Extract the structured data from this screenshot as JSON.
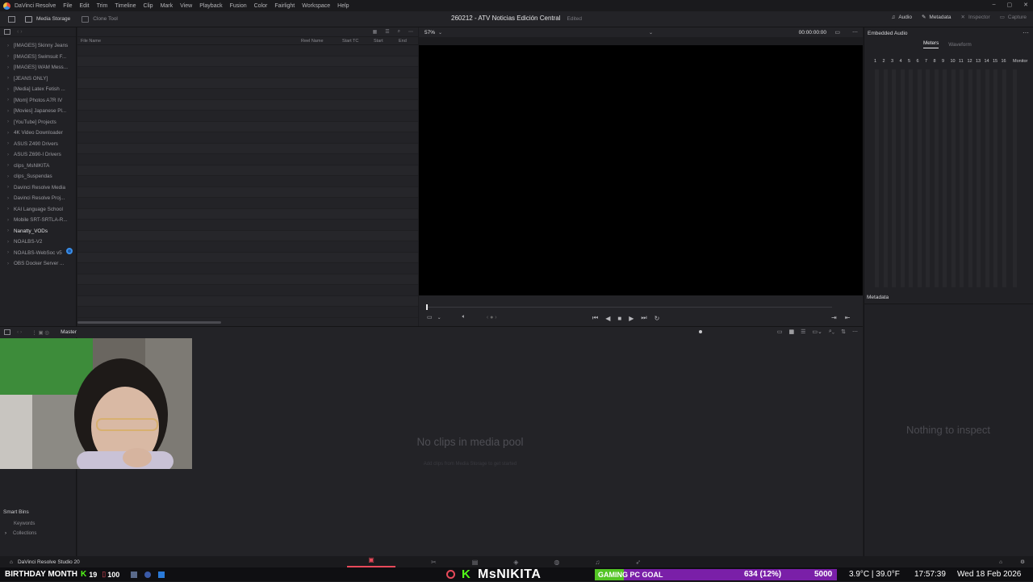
{
  "menubar": {
    "app_name": "DaVinci Resolve",
    "items": [
      "File",
      "Edit",
      "Trim",
      "Timeline",
      "Clip",
      "Mark",
      "View",
      "Playback",
      "Fusion",
      "Color",
      "Fairlight",
      "Workspace",
      "Help"
    ]
  },
  "toolbar": {
    "media_storage": "Media Storage",
    "clone_tool": "Clone Tool",
    "project_title": "260212 - ATV Noticias Edición Central",
    "edited": "Edited",
    "right_items": [
      "Audio",
      "Metadata",
      "Inspector",
      "Capture"
    ]
  },
  "tree": {
    "items": [
      {
        "label": "[IMAGES] Skinny Jeans",
        "bright": false
      },
      {
        "label": "[IMAGES] Swimsuit F...",
        "bright": false
      },
      {
        "label": "[IMAGES] WAM Mess...",
        "bright": false
      },
      {
        "label": "[JEANS ONLY]",
        "bright": false
      },
      {
        "label": "[Media] Latex Fetish ...",
        "bright": false
      },
      {
        "label": "[Mom] Photos A7R IV",
        "bright": false
      },
      {
        "label": "[Movies] Japanese Pl...",
        "bright": false
      },
      {
        "label": "[YouTube] Projects",
        "bright": false
      },
      {
        "label": "4K Video Downloader",
        "bright": false
      },
      {
        "label": "ASUS Z490 Drivers",
        "bright": false
      },
      {
        "label": "ASUS Z690-I Drivers",
        "bright": false
      },
      {
        "label": "clips_MsNIKITA",
        "bright": false
      },
      {
        "label": "clips_Suspendas",
        "bright": false
      },
      {
        "label": "Davinci Resolve Media",
        "bright": false
      },
      {
        "label": "Davinci Resolve Proj...",
        "bright": false
      },
      {
        "label": "KAI Language School",
        "bright": false
      },
      {
        "label": "Mobile SRT-SRTLA-R...",
        "bright": false
      },
      {
        "label": "Nanatty_VODs",
        "bright": true
      },
      {
        "label": "NOALBS-V2",
        "bright": false
      },
      {
        "label": "NOALBS-WebSoc v5",
        "bright": false
      },
      {
        "label": "OBS Docker Server ...",
        "bright": false
      }
    ]
  },
  "browser": {
    "columns": [
      "File Name",
      "Reel Name",
      "Start TC",
      "Start",
      "End"
    ]
  },
  "viewer": {
    "zoom": "57%",
    "timecode": "00:00:00:00"
  },
  "inspector": {
    "panel_title": "Embedded Audio",
    "tabs": [
      "Meters",
      "Waveform"
    ],
    "meter_numbers": [
      "1",
      "2",
      "3",
      "4",
      "5",
      "6",
      "7",
      "8",
      "9",
      "10",
      "11",
      "12",
      "13",
      "14",
      "15",
      "16"
    ],
    "monitor": "Monitor",
    "metadata_title": "Metadata",
    "nothing": "Nothing to inspect"
  },
  "media_pool": {
    "bin": "Master",
    "no_clips": "No clips in media pool",
    "no_clips_sub": "Add clips from Media Storage to get started",
    "smart_bins": "Smart Bins",
    "keywords": "Keywords",
    "collections": "Collections"
  },
  "app_status": {
    "label": "DaVinci Resolve Studio 20"
  },
  "stream": {
    "birthday": "BIRTHDAY MONTH",
    "count1": "19",
    "count2": "100",
    "name": "MsNIKITA",
    "goal": "GAMING PC GOAL",
    "goal_progress": "634 (12%)",
    "goal_target": "5000",
    "goal_fraction": 0.12,
    "weather": "3.9°C | 39.0°F",
    "time": "17:57:39",
    "date": "Wed 18 Feb 2026"
  }
}
